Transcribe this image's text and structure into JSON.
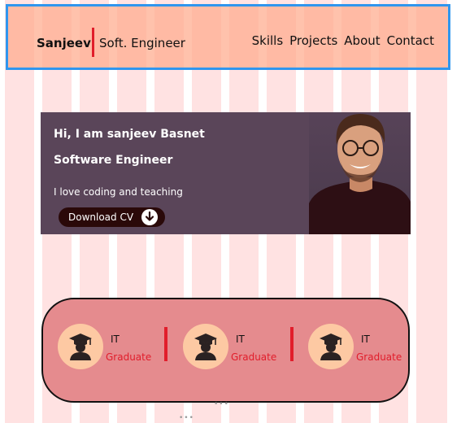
{
  "brand": {
    "name": "Sanjeev",
    "role": "Soft. Engineer"
  },
  "nav": {
    "items": [
      "Skills",
      "Projects",
      "About",
      "Contact"
    ]
  },
  "hero": {
    "greeting": "Hi, I am sanjeev Basnet",
    "title": "Software Engineer",
    "tagline": "I love coding and teaching",
    "cv_button": "Download CV"
  },
  "education": [
    {
      "title": "IT",
      "subtitle": "Graduate"
    },
    {
      "title": "IT",
      "subtitle": "Graduate"
    },
    {
      "title": "IT",
      "subtitle": "Graduate"
    }
  ],
  "colors": {
    "accent": "#e11d2b",
    "nav_outline": "#2f96ee",
    "hero_bg": "#5a4559",
    "card_bg": "#e58b8e"
  },
  "icons": [
    "download-icon",
    "graduate-icon"
  ]
}
